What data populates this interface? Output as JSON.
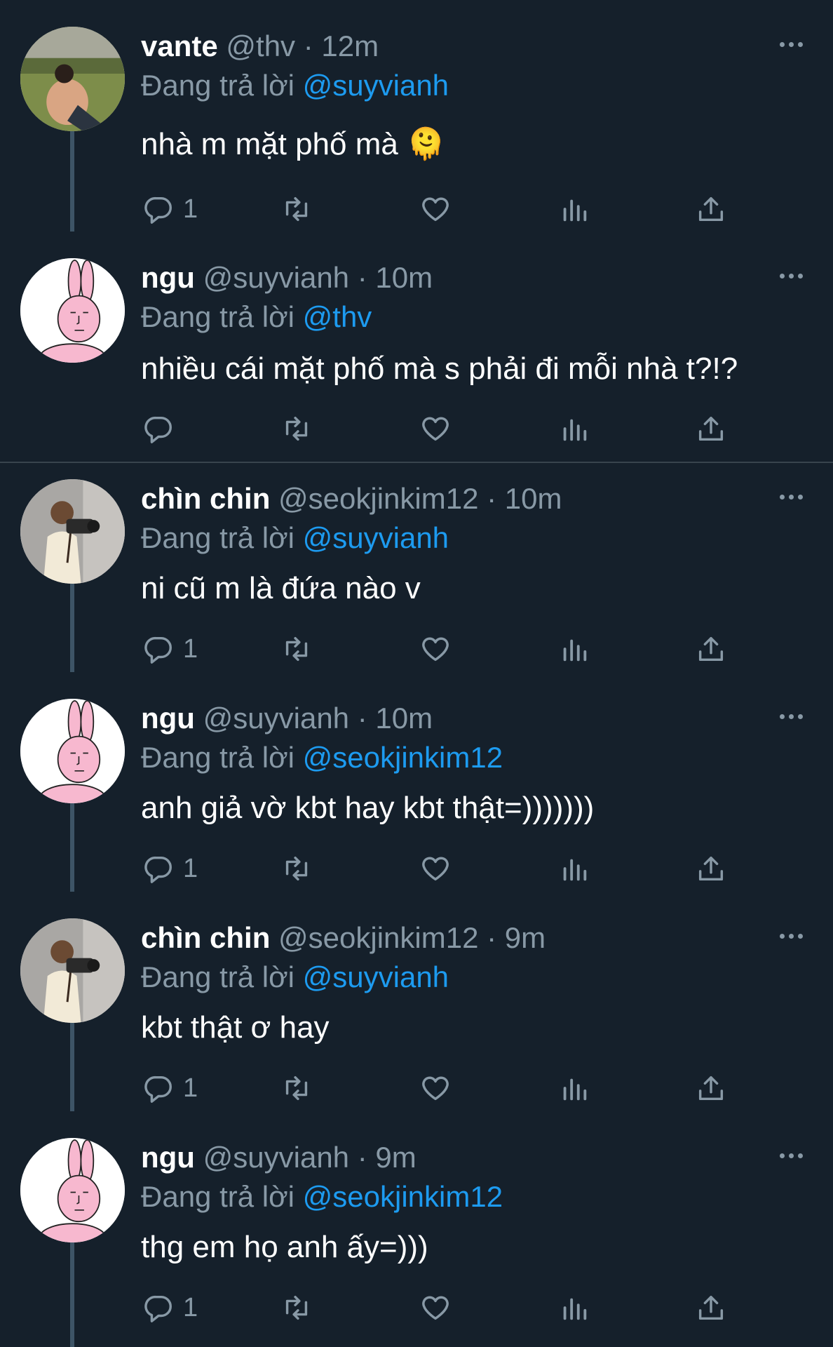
{
  "theme": {
    "background": "#15202b",
    "text": "#ffffff",
    "muted": "#8899a6",
    "link": "#1d9bf0",
    "thread_line": "#3d5466"
  },
  "replying_prefix": "Đang trả lời",
  "separator": "·",
  "tweets": [
    {
      "name": "vante",
      "handle": "@thv",
      "time": "12m",
      "replying_to": "@suyvianh",
      "text": "nhà m mặt phố mà",
      "emoji": "🫠",
      "reply_count": "1",
      "avatar": "photo-person-on-grass"
    },
    {
      "name": "ngu",
      "handle": "@suyvianh",
      "time": "10m",
      "replying_to": "@thv",
      "text": "nhiều cái mặt phố mà s phải đi mỗi nhà t?!?",
      "emoji": "",
      "reply_count": "",
      "avatar": "pink-bunny-drawing"
    },
    {
      "name": "chìn chin",
      "handle": "@seokjinkim12",
      "time": "10m",
      "replying_to": "@suyvianh",
      "text": "ni cũ m là đứa nào v",
      "emoji": "",
      "reply_count": "1",
      "avatar": "photo-man-with-camera"
    },
    {
      "name": "ngu",
      "handle": "@suyvianh",
      "time": "10m",
      "replying_to": "@seokjinkim12",
      "text": "anh giả vờ kbt hay kbt thật=)))))))",
      "emoji": "",
      "reply_count": "1",
      "avatar": "pink-bunny-drawing"
    },
    {
      "name": "chìn chin",
      "handle": "@seokjinkim12",
      "time": "9m",
      "replying_to": "@suyvianh",
      "text": "kbt thật ơ hay",
      "emoji": "",
      "reply_count": "1",
      "avatar": "photo-man-with-camera"
    },
    {
      "name": "ngu",
      "handle": "@suyvianh",
      "time": "9m",
      "replying_to": "@seokjinkim12",
      "text": "thg em họ anh ấy=)))",
      "emoji": "",
      "reply_count": "1",
      "avatar": "pink-bunny-drawing"
    }
  ],
  "action_icons": [
    "reply-icon",
    "retweet-icon",
    "like-icon",
    "views-icon",
    "share-icon"
  ]
}
